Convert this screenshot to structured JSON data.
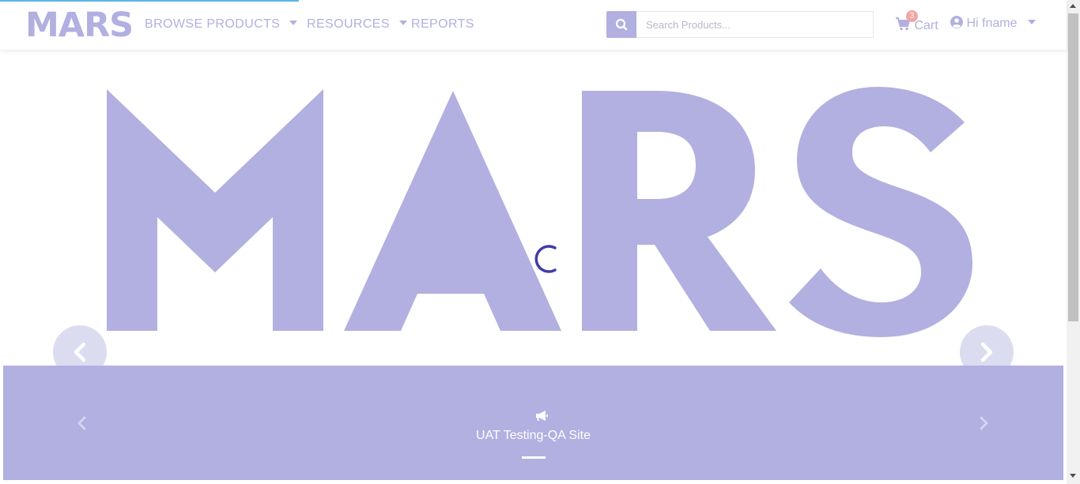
{
  "header": {
    "logo": "MARS",
    "nav": [
      {
        "label": "BROWSE PRODUCTS",
        "has_dropdown": true
      },
      {
        "label": "RESOURCES",
        "has_dropdown": true
      },
      {
        "label": "REPORTS",
        "has_dropdown": false
      }
    ],
    "search": {
      "placeholder": "Search Products...",
      "value": "",
      "icon": "search-icon"
    },
    "cart": {
      "label": "Cart",
      "count": "3",
      "icon": "cart-icon"
    },
    "user": {
      "greeting": "Hi fname",
      "icon": "user-circle-icon"
    }
  },
  "hero": {
    "logo_text": "MARS",
    "loading": true,
    "prev_icon": "chevron-left-icon",
    "next_icon": "chevron-right-icon"
  },
  "announcement": {
    "icon": "megaphone-icon",
    "text": "UAT Testing-QA Site"
  },
  "colors": {
    "brand": "#b1b0e0",
    "spinner": "#3f3dab",
    "badge": "#f4a4a4",
    "top_progress": "#5bb6e8"
  }
}
